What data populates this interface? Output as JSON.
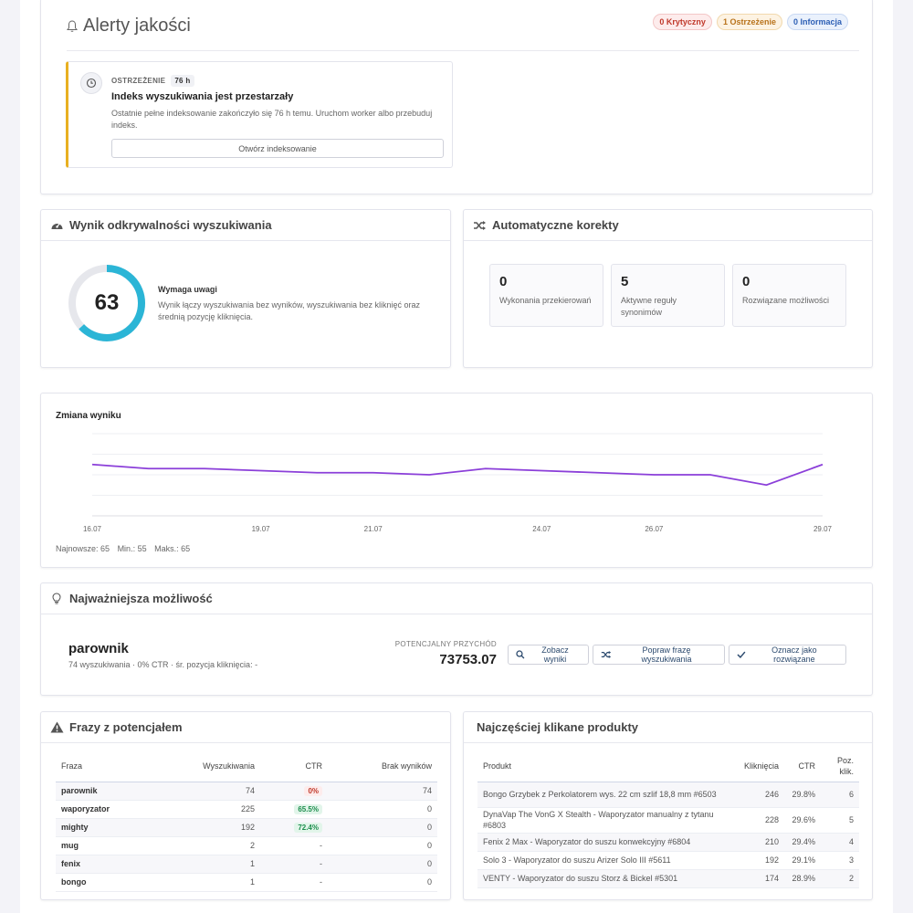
{
  "alerts": {
    "title": "Alerty jakości",
    "badges": {
      "critical": "0 Krytyczny",
      "warning": "1 Ostrzeżenie",
      "info": "0 Informacja"
    },
    "item": {
      "label": "OSTRZEŻENIE",
      "age": "76 h",
      "title": "Indeks wyszukiwania jest przestarzały",
      "description": "Ostatnie pełne indeksowanie zakończyło się 76 h temu. Uruchom worker albo przebuduj indeks.",
      "button": "Otwórz indeksowanie"
    }
  },
  "score": {
    "title": "Wynik odkrywalności wyszukiwania",
    "value": "63",
    "fraction": 0.63,
    "heading": "Wymaga uwagi",
    "description": "Wynik łączy wyszukiwania bez wyników, wyszukiwania bez kliknięć oraz średnią pozycję kliknięcia."
  },
  "auto": {
    "title": "Automatyczne korekty",
    "stats": [
      {
        "value": "0",
        "label": "Wykonania przekierowań"
      },
      {
        "value": "5",
        "label": "Aktywne reguły synonimów"
      },
      {
        "value": "0",
        "label": "Rozwiązane możliwości"
      }
    ]
  },
  "trend": {
    "title": "Zmiana wyniku",
    "stats": {
      "latest": "Najnowsze: 65",
      "min": "Min.: 55",
      "max": "Maks.: 65"
    }
  },
  "chart_data": {
    "type": "line",
    "title": "Zmiana wyniku",
    "x_ticks": [
      "16.07",
      "19.07",
      "21.07",
      "24.07",
      "26.07",
      "29.07"
    ],
    "x": [
      16,
      17,
      18,
      19,
      20,
      21,
      22,
      23,
      24,
      25,
      26,
      27,
      28,
      29
    ],
    "y": [
      65,
      63,
      63,
      62,
      61,
      61,
      60,
      63,
      62,
      61,
      60,
      60,
      55,
      65
    ],
    "ylim": [
      40,
      80
    ],
    "grid": true
  },
  "opportunity": {
    "title": "Najważniejsza możliwość",
    "phrase": "parownik",
    "meta": "74 wyszukiwania · 0% CTR · śr. pozycja kliknięcia: -",
    "revenue_label": "POTENCJALNY PRZYCHÓD",
    "revenue": "73753.07",
    "buttons": {
      "results": "Zobacz wyniki",
      "fix": "Popraw frazę wyszukiwania",
      "resolve": "Oznacz jako rozwiązane"
    }
  },
  "phrases": {
    "title": "Frazy z potencjałem",
    "columns": [
      "Fraza",
      "Wyszukiwania",
      "CTR",
      "Brak wyników"
    ],
    "rows": [
      {
        "phrase": "parownik",
        "searches": "74",
        "ctr": "0%",
        "ctr_type": "bad",
        "no_results": "74"
      },
      {
        "phrase": "waporyzator",
        "searches": "225",
        "ctr": "65.5%",
        "ctr_type": "good",
        "no_results": "0"
      },
      {
        "phrase": "mighty",
        "searches": "192",
        "ctr": "72.4%",
        "ctr_type": "good",
        "no_results": "0"
      },
      {
        "phrase": "mug",
        "searches": "2",
        "ctr": "-",
        "ctr_type": "none",
        "no_results": "0"
      },
      {
        "phrase": "fenix",
        "searches": "1",
        "ctr": "-",
        "ctr_type": "none",
        "no_results": "0"
      },
      {
        "phrase": "bongo",
        "searches": "1",
        "ctr": "-",
        "ctr_type": "none",
        "no_results": "0"
      }
    ]
  },
  "products": {
    "title": "Najczęściej klikane produkty",
    "columns": [
      "Produkt",
      "Kliknięcia",
      "CTR",
      "Poz. klik."
    ],
    "rows": [
      {
        "name": "Bongo Grzybek z Perkolatorem wys. 22 cm szlif 18,8 mm #6503",
        "clicks": "246",
        "ctr": "29.8%",
        "pos": "6"
      },
      {
        "name": "DynaVap The VonG X Stealth - Waporyzator manualny z tytanu #6803",
        "clicks": "228",
        "ctr": "29.6%",
        "pos": "5"
      },
      {
        "name": "Fenix 2 Max - Waporyzator do suszu konwekcyjny #6804",
        "clicks": "210",
        "ctr": "29.4%",
        "pos": "4"
      },
      {
        "name": "Solo 3 - Waporyzator do suszu Arizer Solo III #5611",
        "clicks": "192",
        "ctr": "29.1%",
        "pos": "3"
      },
      {
        "name": "VENTY - Waporyzator do suszu Storz & Bickel #5301",
        "clicks": "174",
        "ctr": "28.9%",
        "pos": "2"
      }
    ]
  }
}
